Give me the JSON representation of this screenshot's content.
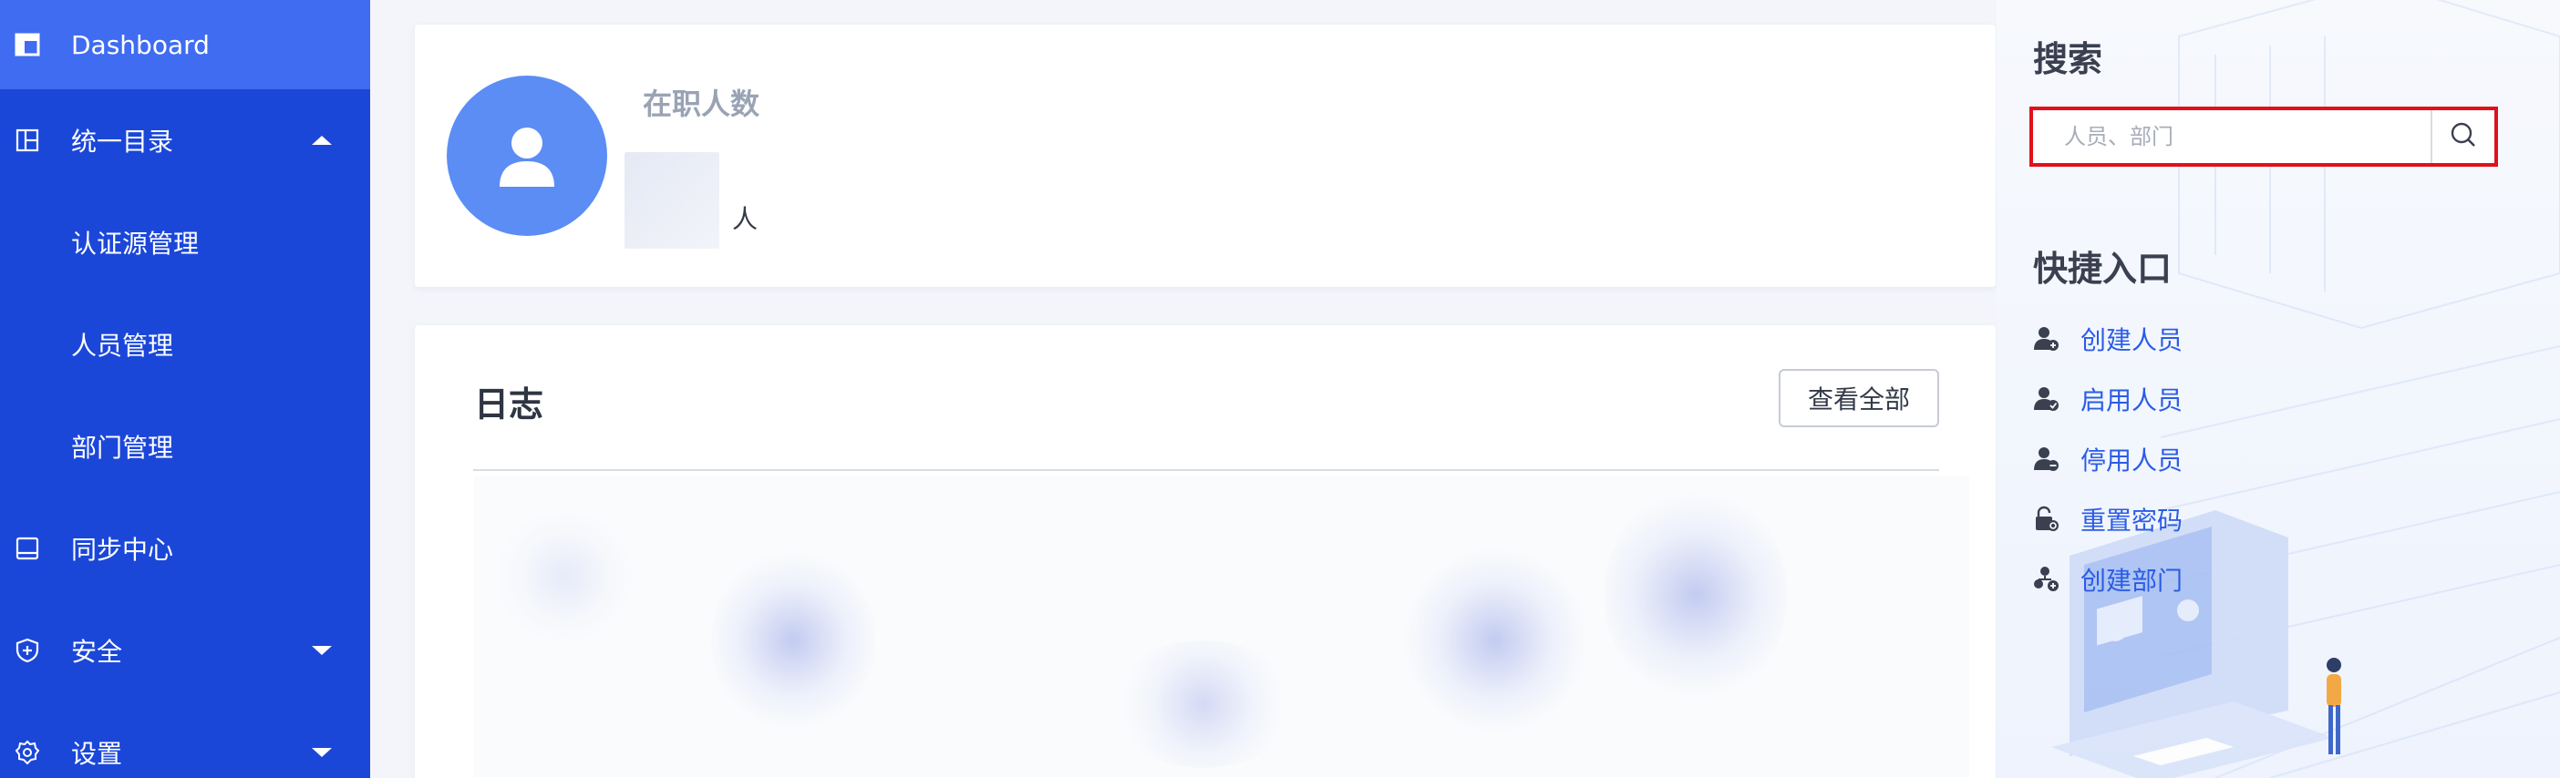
{
  "sidebar": {
    "items": [
      {
        "label": "Dashboard",
        "icon": "dashboard-icon"
      },
      {
        "label": "统一目录",
        "icon": "directory-icon"
      },
      {
        "label": "认证源管理"
      },
      {
        "label": "人员管理"
      },
      {
        "label": "部门管理"
      },
      {
        "label": "同步中心",
        "icon": "sync-icon"
      },
      {
        "label": "安全",
        "icon": "shield-icon"
      },
      {
        "label": "设置",
        "icon": "gear-icon"
      }
    ]
  },
  "stats": {
    "label": "在职人数",
    "unit": "人"
  },
  "log": {
    "title": "日志",
    "view_all": "查看全部"
  },
  "search": {
    "title": "搜索",
    "placeholder": "人员、部门"
  },
  "quick": {
    "title": "快捷入口",
    "items": [
      {
        "label": "创建人员",
        "icon": "user-add-icon"
      },
      {
        "label": "启用人员",
        "icon": "user-enable-icon"
      },
      {
        "label": "停用人员",
        "icon": "user-disable-icon"
      },
      {
        "label": "重置密码",
        "icon": "lock-reset-icon"
      },
      {
        "label": "创建部门",
        "icon": "department-add-icon"
      }
    ]
  },
  "colors": {
    "sidebar": "#1b47d9",
    "sidebar_active": "#3f6cf0",
    "accent": "#2b5ce6",
    "highlight": "#e0111b"
  }
}
